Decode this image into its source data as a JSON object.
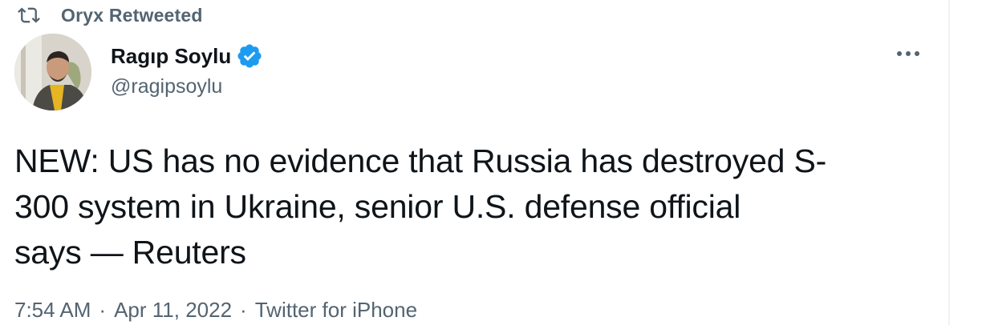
{
  "context": {
    "retweet_label": "Oryx Retweeted",
    "icon": "retweet-icon"
  },
  "author": {
    "name": "Ragıp Soylu",
    "handle": "@ragipsoylu",
    "verified": true,
    "verified_icon": "verified-badge-icon"
  },
  "menu": {
    "icon": "more-options-icon"
  },
  "tweet": {
    "text_lines": [
      "NEW: US has no evidence that Russia has destroyed S-",
      "300 system in Ukraine, senior U.S. defense official",
      "says — Reuters"
    ]
  },
  "meta": {
    "time": "7:54 AM",
    "separator": "·",
    "date": "Apr 11, 2022",
    "source": "Twitter for iPhone"
  },
  "colors": {
    "text_primary": "#0f1419",
    "text_secondary": "#536471",
    "verified_blue": "#1d9bf0",
    "border": "#eff3f4"
  }
}
